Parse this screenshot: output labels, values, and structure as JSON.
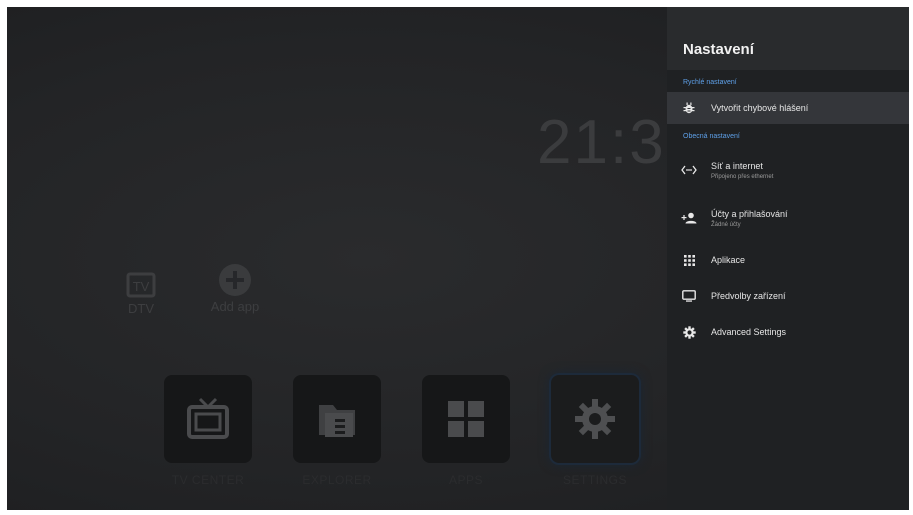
{
  "launcher": {
    "clock": "21:3",
    "mini_apps": [
      {
        "label": "DTV",
        "icon": "tv-icon"
      },
      {
        "label": "Add app",
        "icon": "plus-icon"
      }
    ],
    "dock": [
      {
        "label": "TV CENTER",
        "icon": "tv-icon"
      },
      {
        "label": "EXPLORER",
        "icon": "folder-icon"
      },
      {
        "label": "APPS",
        "icon": "apps-grid-icon"
      },
      {
        "label": "SETTINGS",
        "icon": "gear-icon"
      }
    ]
  },
  "settings": {
    "title": "Nastavení",
    "quick_section": "Rychlé nastavení",
    "quick_items": [
      {
        "label": "Vytvořit chybové hlášení",
        "icon": "bug-icon"
      }
    ],
    "general_section": "Obecná nastavení",
    "general_items": [
      {
        "label": "Síť a internet",
        "sub": "Připojeno přes ethernet",
        "icon": "network-icon"
      },
      {
        "label": "Účty a přihlašování",
        "sub": "Žádné účty",
        "icon": "add-account-icon"
      },
      {
        "label": "Aplikace",
        "icon": "apps-icon"
      },
      {
        "label": "Předvolby zařízení",
        "icon": "monitor-icon"
      },
      {
        "label": "Advanced Settings",
        "icon": "gear-icon"
      }
    ]
  },
  "colors": {
    "accent": "#5ea0e8",
    "panel_bg": "#1f2123",
    "header_bg": "#292b2d",
    "highlight_bg": "#34363a"
  }
}
